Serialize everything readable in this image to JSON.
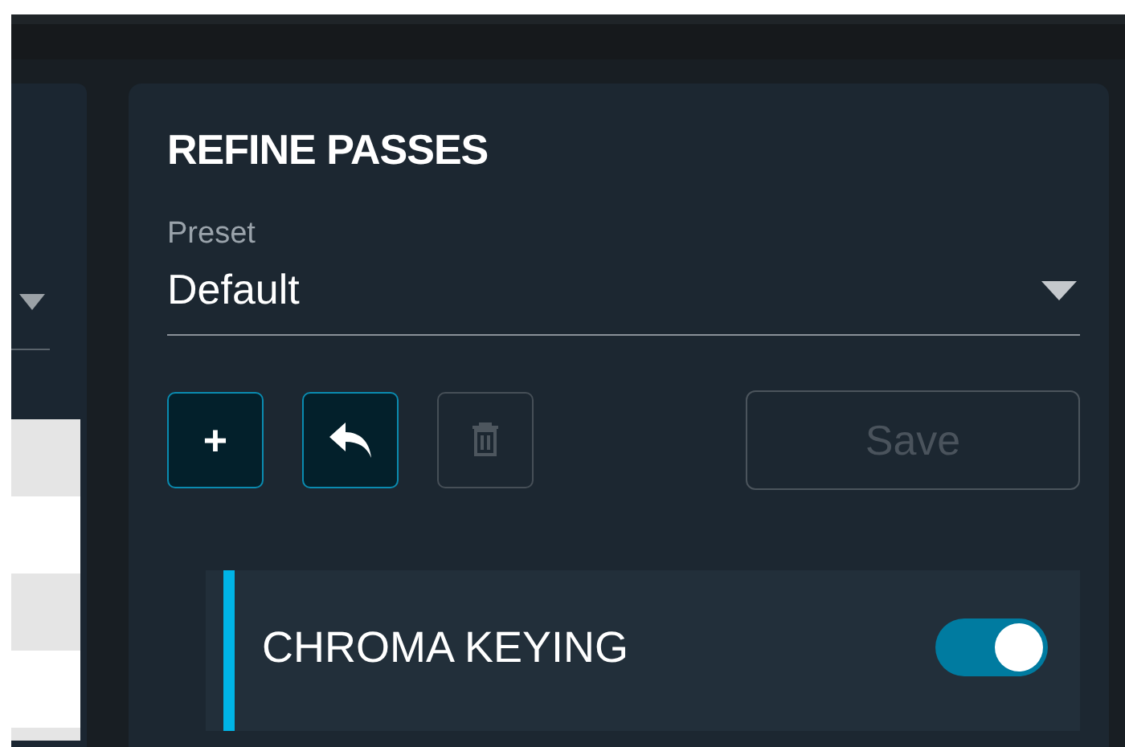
{
  "refine_passes": {
    "title": "REFINE PASSES",
    "preset": {
      "label": "Preset",
      "value": "Default"
    },
    "actions": [
      {
        "kind": "add",
        "label": "+",
        "disabled": false
      },
      {
        "kind": "undo",
        "disabled": false
      },
      {
        "kind": "delete",
        "disabled": true
      }
    ],
    "save": {
      "label": "Save",
      "disabled": true
    },
    "passes": [
      {
        "name": "CHROMA KEYING",
        "on": true
      }
    ]
  }
}
